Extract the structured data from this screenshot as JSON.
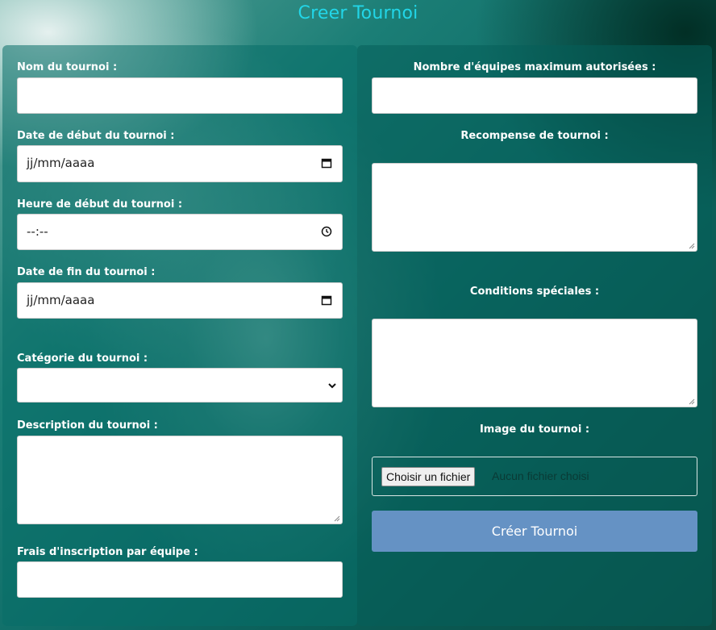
{
  "page": {
    "title": "Creer Tournoi"
  },
  "left": {
    "name_label": "Nom du tournoi :",
    "name_value": "",
    "start_date_label": "Date de début du tournoi :",
    "start_date_value": "jj/mm/aaaa",
    "start_time_label": "Heure de début du tournoi :",
    "start_time_value": "--:--",
    "end_date_label": "Date de fin du tournoi :",
    "end_date_value": "jj/mm/aaaa",
    "category_label": "Catégorie du tournoi :",
    "category_value": "",
    "description_label": "Description du tournoi :",
    "description_value": "",
    "fee_label": "Frais d'inscription par équipe :",
    "fee_value": ""
  },
  "right": {
    "max_teams_label": "Nombre d'équipes maximum autorisées :",
    "max_teams_value": "",
    "reward_label": "Recompense de tournoi :",
    "reward_value": "",
    "conditions_label": "Conditions spéciales :",
    "conditions_value": "",
    "image_label": "Image du tournoi :",
    "file_button_label": "Choisir un fichier",
    "file_status": "Aucun fichier choisi",
    "submit_label": "Créer Tournoi"
  },
  "icons": {
    "date": "calendar-icon",
    "time": "clock-icon",
    "select": "chevron-down-icon"
  },
  "colors": {
    "title": "#22d6e8",
    "submit_button": "#6592c4",
    "label_text": "#ffffff"
  }
}
